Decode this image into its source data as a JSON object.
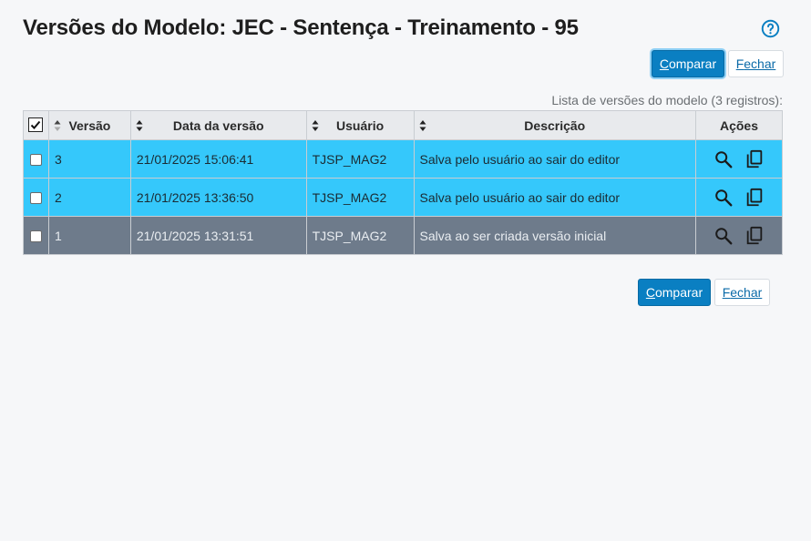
{
  "page": {
    "title": "Versões do Modelo: JEC - Sentença - Treinamento - 95"
  },
  "buttons": {
    "compare_prefix": "C",
    "compare_rest": "omparar",
    "close_prefix": "F",
    "close_rest": "echar"
  },
  "caption": "Lista de versões do modelo (3 registros):",
  "table": {
    "headers": {
      "version": "Versão",
      "date": "Data da versão",
      "user": "Usuário",
      "description": "Descrição",
      "actions": "Ações"
    },
    "rows": [
      {
        "version": "3",
        "date": "21/01/2025 15:06:41",
        "user": "TJSP_MAG2",
        "description": "Salva pelo usuário ao sair do editor"
      },
      {
        "version": "2",
        "date": "21/01/2025 13:36:50",
        "user": "TJSP_MAG2",
        "description": "Salva pelo usuário ao sair do editor"
      },
      {
        "version": "1",
        "date": "21/01/2025 13:31:51",
        "user": "TJSP_MAG2",
        "description": "Salva ao ser criada versão inicial"
      }
    ]
  },
  "colors": {
    "primary": "#0a7fc2",
    "selected_row": "#35c8fb",
    "dark_row": "#6e7b8b"
  },
  "icons": [
    "help-circle-icon",
    "sort-icon",
    "search-icon",
    "copy-icon"
  ]
}
